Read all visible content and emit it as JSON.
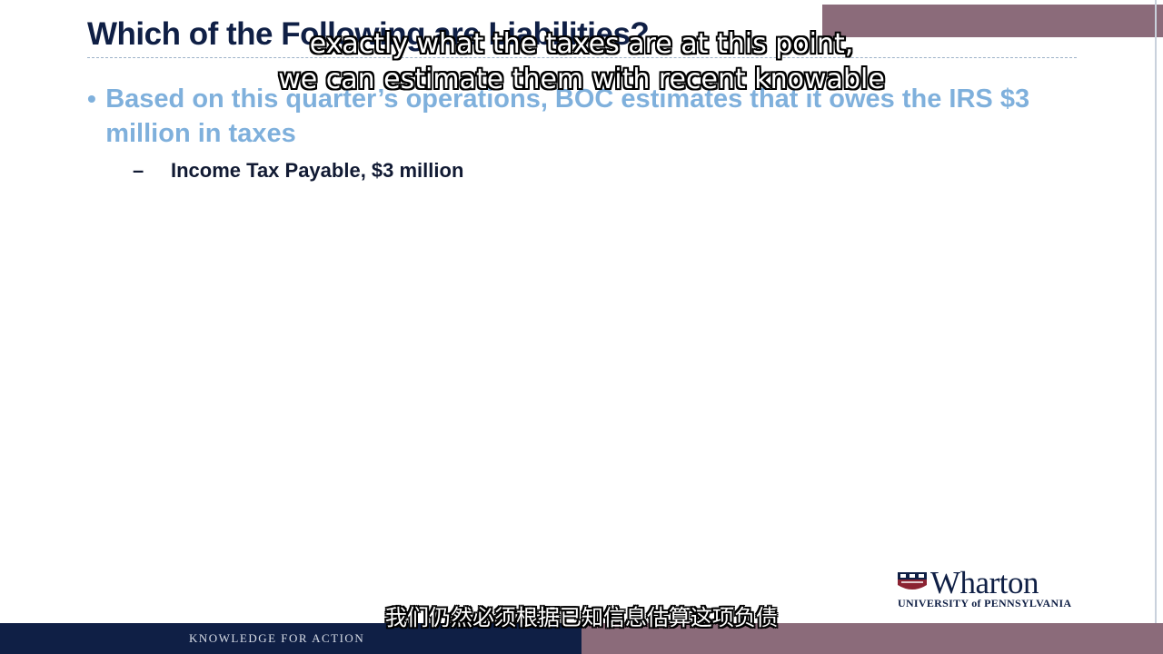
{
  "slide": {
    "title": "Which of the Following are Liabilities?",
    "bullet": "Based on this quarter’s operations, BOC estimates that it owes the IRS $3 million in taxes",
    "sub_dash": "–",
    "sub_item": "Income Tax Payable, $3 million"
  },
  "subtitles": {
    "line1": "exactly what the taxes are at this point,",
    "line2": "we can estimate them with recent knowable",
    "chinese": "我们仍然必须根据已知信息估算这项负债"
  },
  "logo": {
    "name": "Wharton",
    "subtitle": "UNIVERSITY of PENNSYLVANIA"
  },
  "footer": {
    "tagline": "KNOWLEDGE FOR ACTION"
  },
  "colors": {
    "navy": "#0f1f45",
    "mauve": "#8b6b7a",
    "bullet_blue": "#7fb0dc"
  }
}
